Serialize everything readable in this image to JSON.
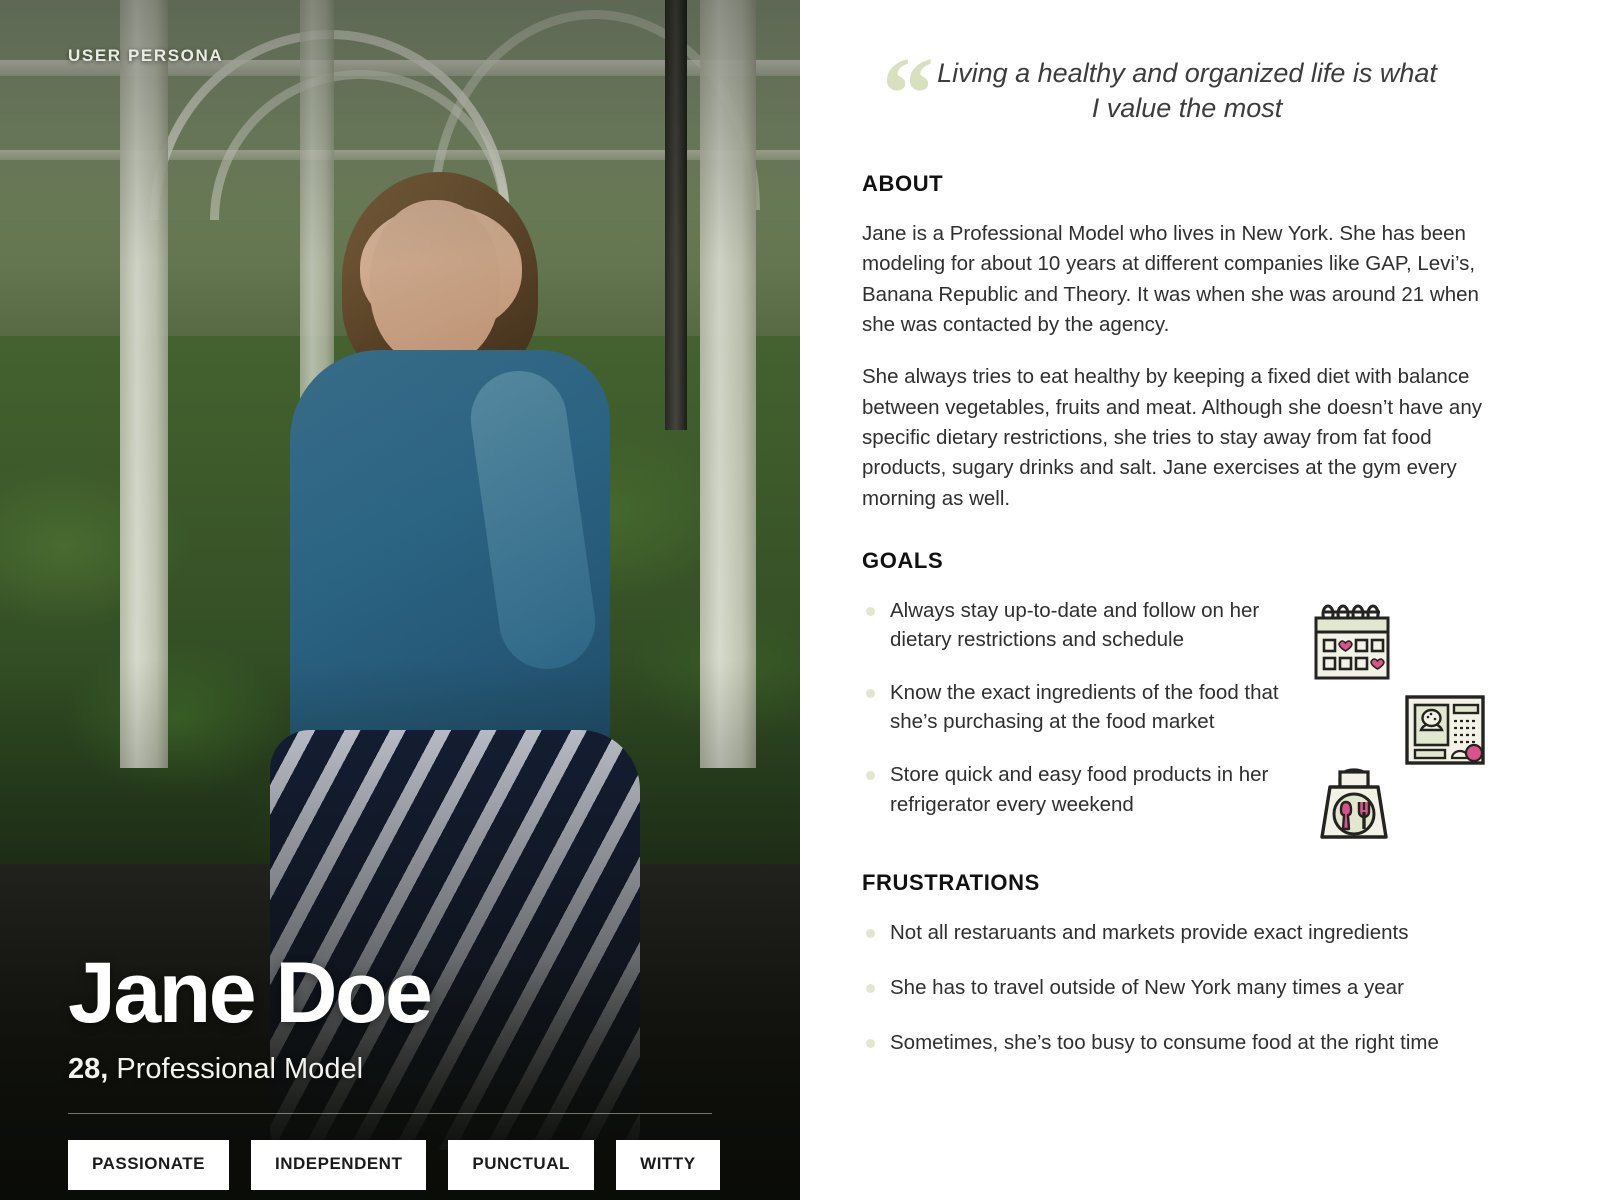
{
  "card": {
    "eyebrow": "USER PERSONA"
  },
  "profile": {
    "name": "Jane Doe",
    "age": "28,",
    "occupation": " Professional Model",
    "tags": [
      {
        "label": "PASSIONATE"
      },
      {
        "label": "INDEPENDENT"
      },
      {
        "label": "PUNCTUAL"
      },
      {
        "label": "WITTY"
      }
    ]
  },
  "quote": {
    "mark": "“",
    "text": "Living a healthy and organized life is what I value the most"
  },
  "about": {
    "title": "ABOUT",
    "paragraphs": [
      "Jane is a Professional Model who lives in New York. She has been modeling for about 10 years at different companies like GAP, Levi’s, Banana Republic and Theory. It was when she was around 21 when she was contacted by the agency.",
      "She always tries to eat healthy by keeping a fixed diet with balance between vegetables, fruits and meat. Although she doesn’t have any specific dietary restrictions, she tries to stay away from fat food products, sugary drinks and salt. Jane exercises at the gym every morning as well."
    ]
  },
  "goals": {
    "title": "GOALS",
    "items": [
      "Always stay up-to-date and follow on her dietary restrictions and schedule",
      "Know the exact ingredients of the food that she’s purchasing at the food market",
      "Store quick and easy food products in her refrigerator every weekend"
    ],
    "icons": [
      {
        "name": "calendar-heart-icon"
      },
      {
        "name": "recipe-menu-icon"
      },
      {
        "name": "shopping-bag-food-icon"
      }
    ]
  },
  "frustrations": {
    "title": "FRUSTRATIONS",
    "items": [
      "Not all restaruants and markets provide exact ingredients",
      "She has to travel outside of New York many times a year",
      "Sometimes, she’s too busy to consume food at the right time"
    ]
  },
  "colors": {
    "accent_sage": "#d9e0bd",
    "bullet": "#e2e6cf",
    "text_dark": "#2f2f2f",
    "heading": "#111111",
    "panel_bg": "#ffffff",
    "icon_fill": "#eceedd",
    "icon_pink": "#d9538a",
    "icon_stroke": "#23231f"
  }
}
